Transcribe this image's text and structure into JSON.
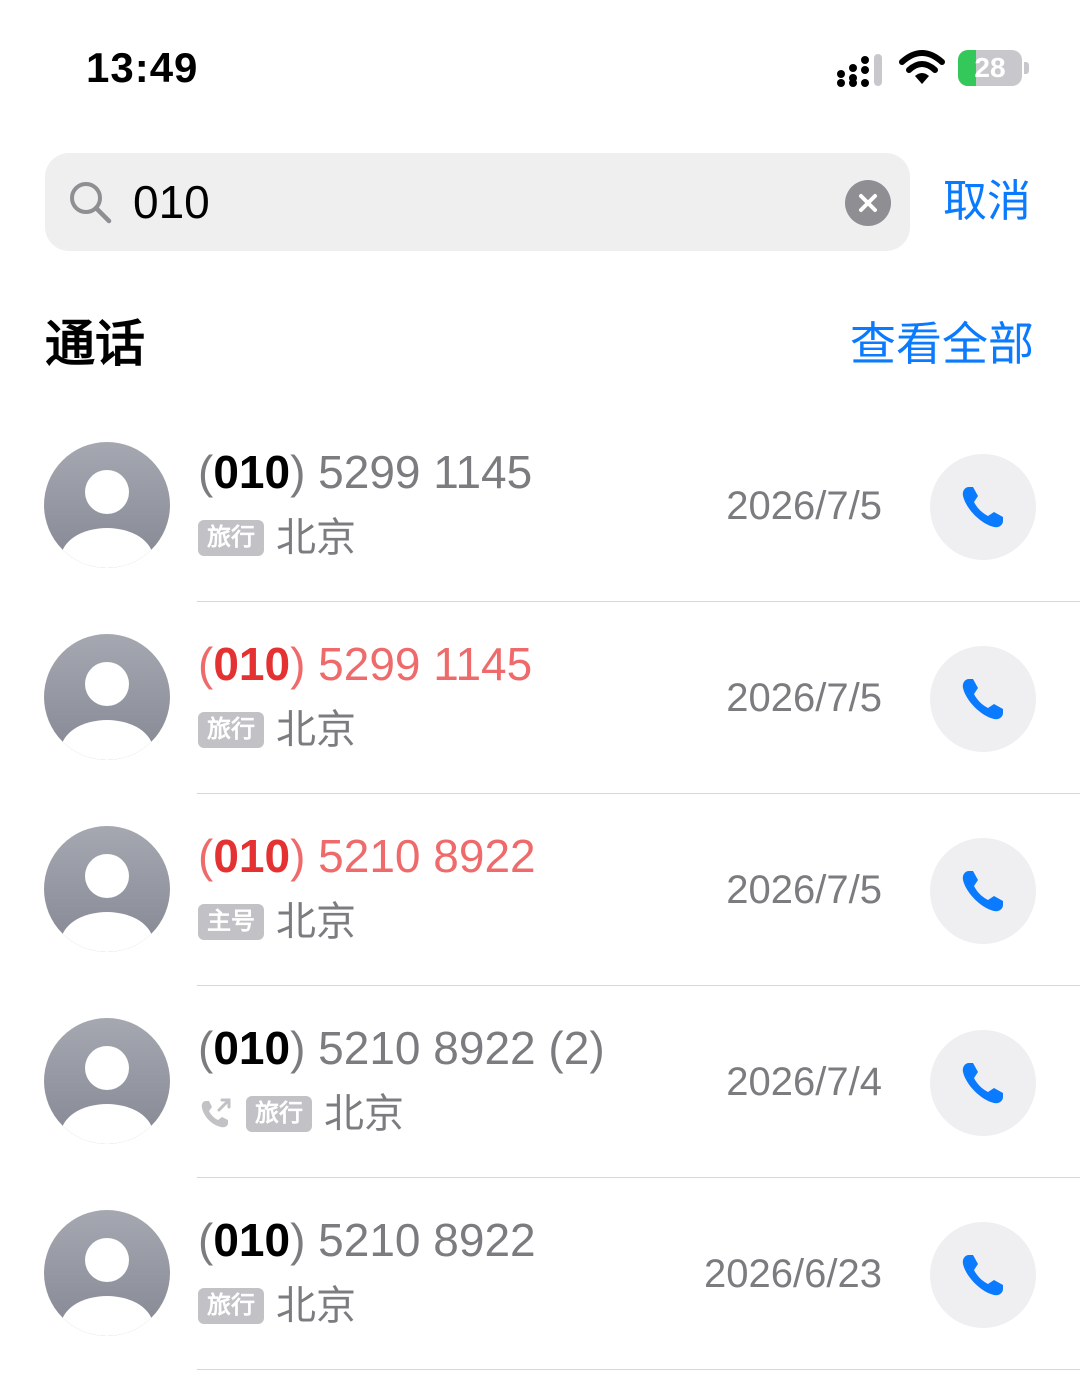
{
  "status_bar": {
    "time": "13:49",
    "battery": "28",
    "battery_level": 0.28,
    "icons": [
      "signal-icon",
      "wifi-icon",
      "battery-charging-icon"
    ]
  },
  "search": {
    "query": "010",
    "placeholder": "",
    "cancel_label": "取消"
  },
  "section": {
    "title": "通话",
    "see_all_label": "查看全部"
  },
  "colors": {
    "accent": "#0a7aff",
    "missed": "#e43131",
    "secondary_text": "#7c7c80"
  },
  "calls": [
    {
      "area": "010",
      "rest": " 5299 1145",
      "count": "",
      "tag": "旅行",
      "location": "北京",
      "date": "2026/7/5",
      "missed": false,
      "outgoing": false
    },
    {
      "area": "010",
      "rest": " 5299 1145",
      "count": "",
      "tag": "旅行",
      "location": "北京",
      "date": "2026/7/5",
      "missed": true,
      "outgoing": false
    },
    {
      "area": "010",
      "rest": " 5210 8922",
      "count": "",
      "tag": "主号",
      "location": "北京",
      "date": "2026/7/5",
      "missed": true,
      "outgoing": false
    },
    {
      "area": "010",
      "rest": " 5210 8922",
      "count": " (2)",
      "tag": "旅行",
      "location": "北京",
      "date": "2026/7/4",
      "missed": false,
      "outgoing": true
    },
    {
      "area": "010",
      "rest": " 5210 8922",
      "count": "",
      "tag": "旅行",
      "location": "北京",
      "date": "2026/6/23",
      "missed": false,
      "outgoing": false
    }
  ]
}
